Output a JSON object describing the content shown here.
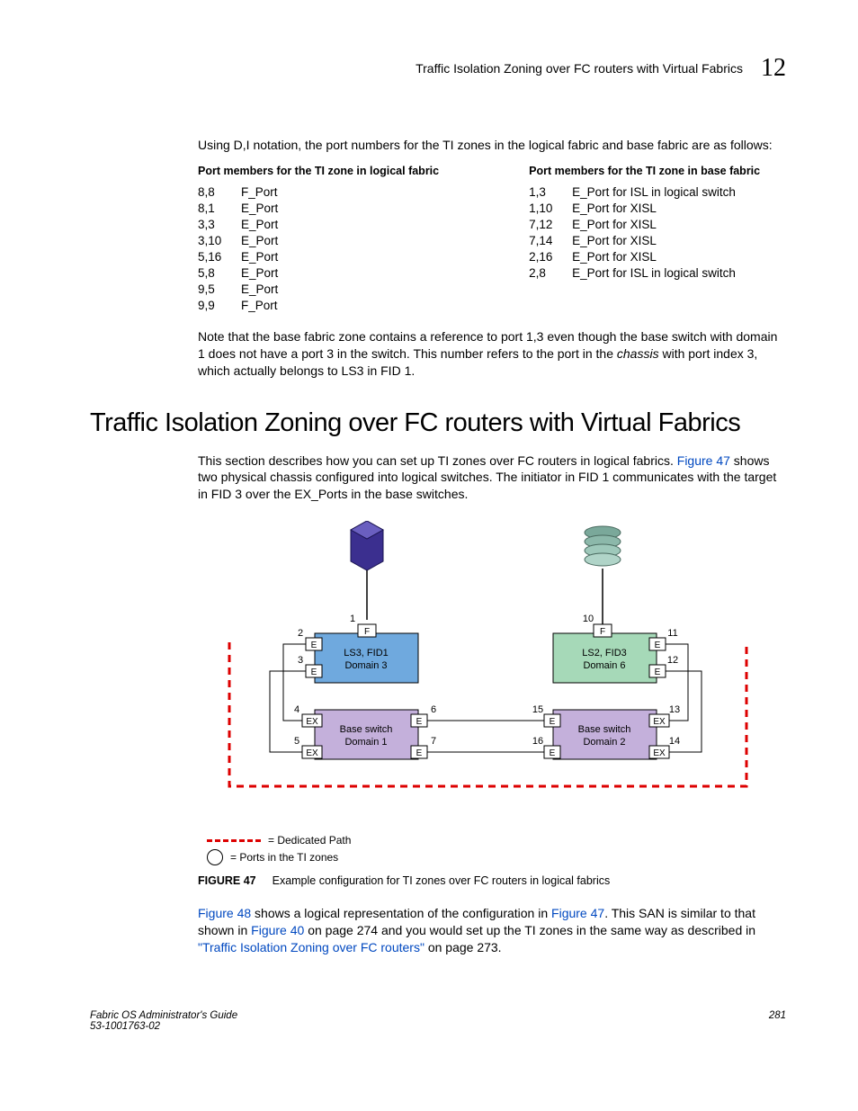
{
  "header": {
    "running_title": "Traffic Isolation Zoning over FC routers with Virtual Fabrics",
    "chapter": "12"
  },
  "intro": "Using D,I notation, the port numbers for the TI zones in the logical fabric and base fabric are as follows:",
  "logical_title": "Port members for the TI zone in logical fabric",
  "logical_rows": [
    [
      "8,8",
      "F_Port"
    ],
    [
      "8,1",
      "E_Port"
    ],
    [
      "3,3",
      "E_Port"
    ],
    [
      "3,10",
      "E_Port"
    ],
    [
      "5,16",
      "E_Port"
    ],
    [
      "5,8",
      "E_Port"
    ],
    [
      "9,5",
      "E_Port"
    ],
    [
      "9,9",
      "F_Port"
    ]
  ],
  "base_title": "Port members for the TI zone in base fabric",
  "base_rows": [
    [
      "1,3",
      "E_Port for ISL in logical switch"
    ],
    [
      "1,10",
      "E_Port for XISL"
    ],
    [
      "7,12",
      "E_Port for XISL"
    ],
    [
      "7,14",
      "E_Port for XISL"
    ],
    [
      "2,16",
      "E_Port for XISL"
    ],
    [
      "2,8",
      "E_Port for ISL in logical switch"
    ]
  ],
  "note": {
    "pre": "Note that the base fabric zone contains a reference to port 1,3 even though the base switch with domain 1 does not have a port 3 in the switch. This number refers to the port in the ",
    "em": "chassis",
    "post": " with port index 3, which actually belongs to LS3 in FID 1."
  },
  "h1": "Traffic Isolation Zoning over FC routers with Virtual Fabrics",
  "para2": {
    "pre": "This section describes how you can set up TI zones over FC routers in logical fabrics. ",
    "link": "Figure 47",
    "post": " shows two physical chassis configured into logical switches. The initiator in FID 1 communicates with the target in FID 3 over the EX_Ports in the base switches."
  },
  "diagram": {
    "ls3": {
      "l1": "LS3, FID1",
      "l2": "Domain 3"
    },
    "ls2": {
      "l1": "LS2, FID3",
      "l2": "Domain 6"
    },
    "bs1": {
      "l1": "Base switch",
      "l2": "Domain 1"
    },
    "bs2": {
      "l1": "Base switch",
      "l2": "Domain 2"
    },
    "ports": {
      "p1": "1",
      "p2": "2",
      "p3": "3",
      "p4": "4",
      "p5": "5",
      "p6": "6",
      "p7": "7",
      "p10": "10",
      "p11": "11",
      "p12": "12",
      "p13": "13",
      "p14": "14",
      "p15": "15",
      "p16": "16"
    },
    "lbl": {
      "F": "F",
      "E": "E",
      "EX": "EX"
    }
  },
  "legend": {
    "dedicated": "= Dedicated Path",
    "ports": "= Ports in the TI zones"
  },
  "figcap": {
    "tag": "FIGURE 47",
    "text": "Example configuration for TI zones over FC routers in logical fabrics"
  },
  "para3": {
    "l1": "Figure 48",
    "t1": " shows a logical representation of the configuration in ",
    "l2": "Figure 47",
    "t2": ". This SAN is similar to that shown in ",
    "l3": "Figure 40",
    "t3": " on page 274 and you would set up the TI zones in the same way as described in ",
    "l4": "\"Traffic Isolation Zoning over FC routers\"",
    "t4": " on page 273."
  },
  "footer": {
    "l1": "Fabric OS Administrator's Guide",
    "l2": "53-1001763-02",
    "page": "281"
  }
}
